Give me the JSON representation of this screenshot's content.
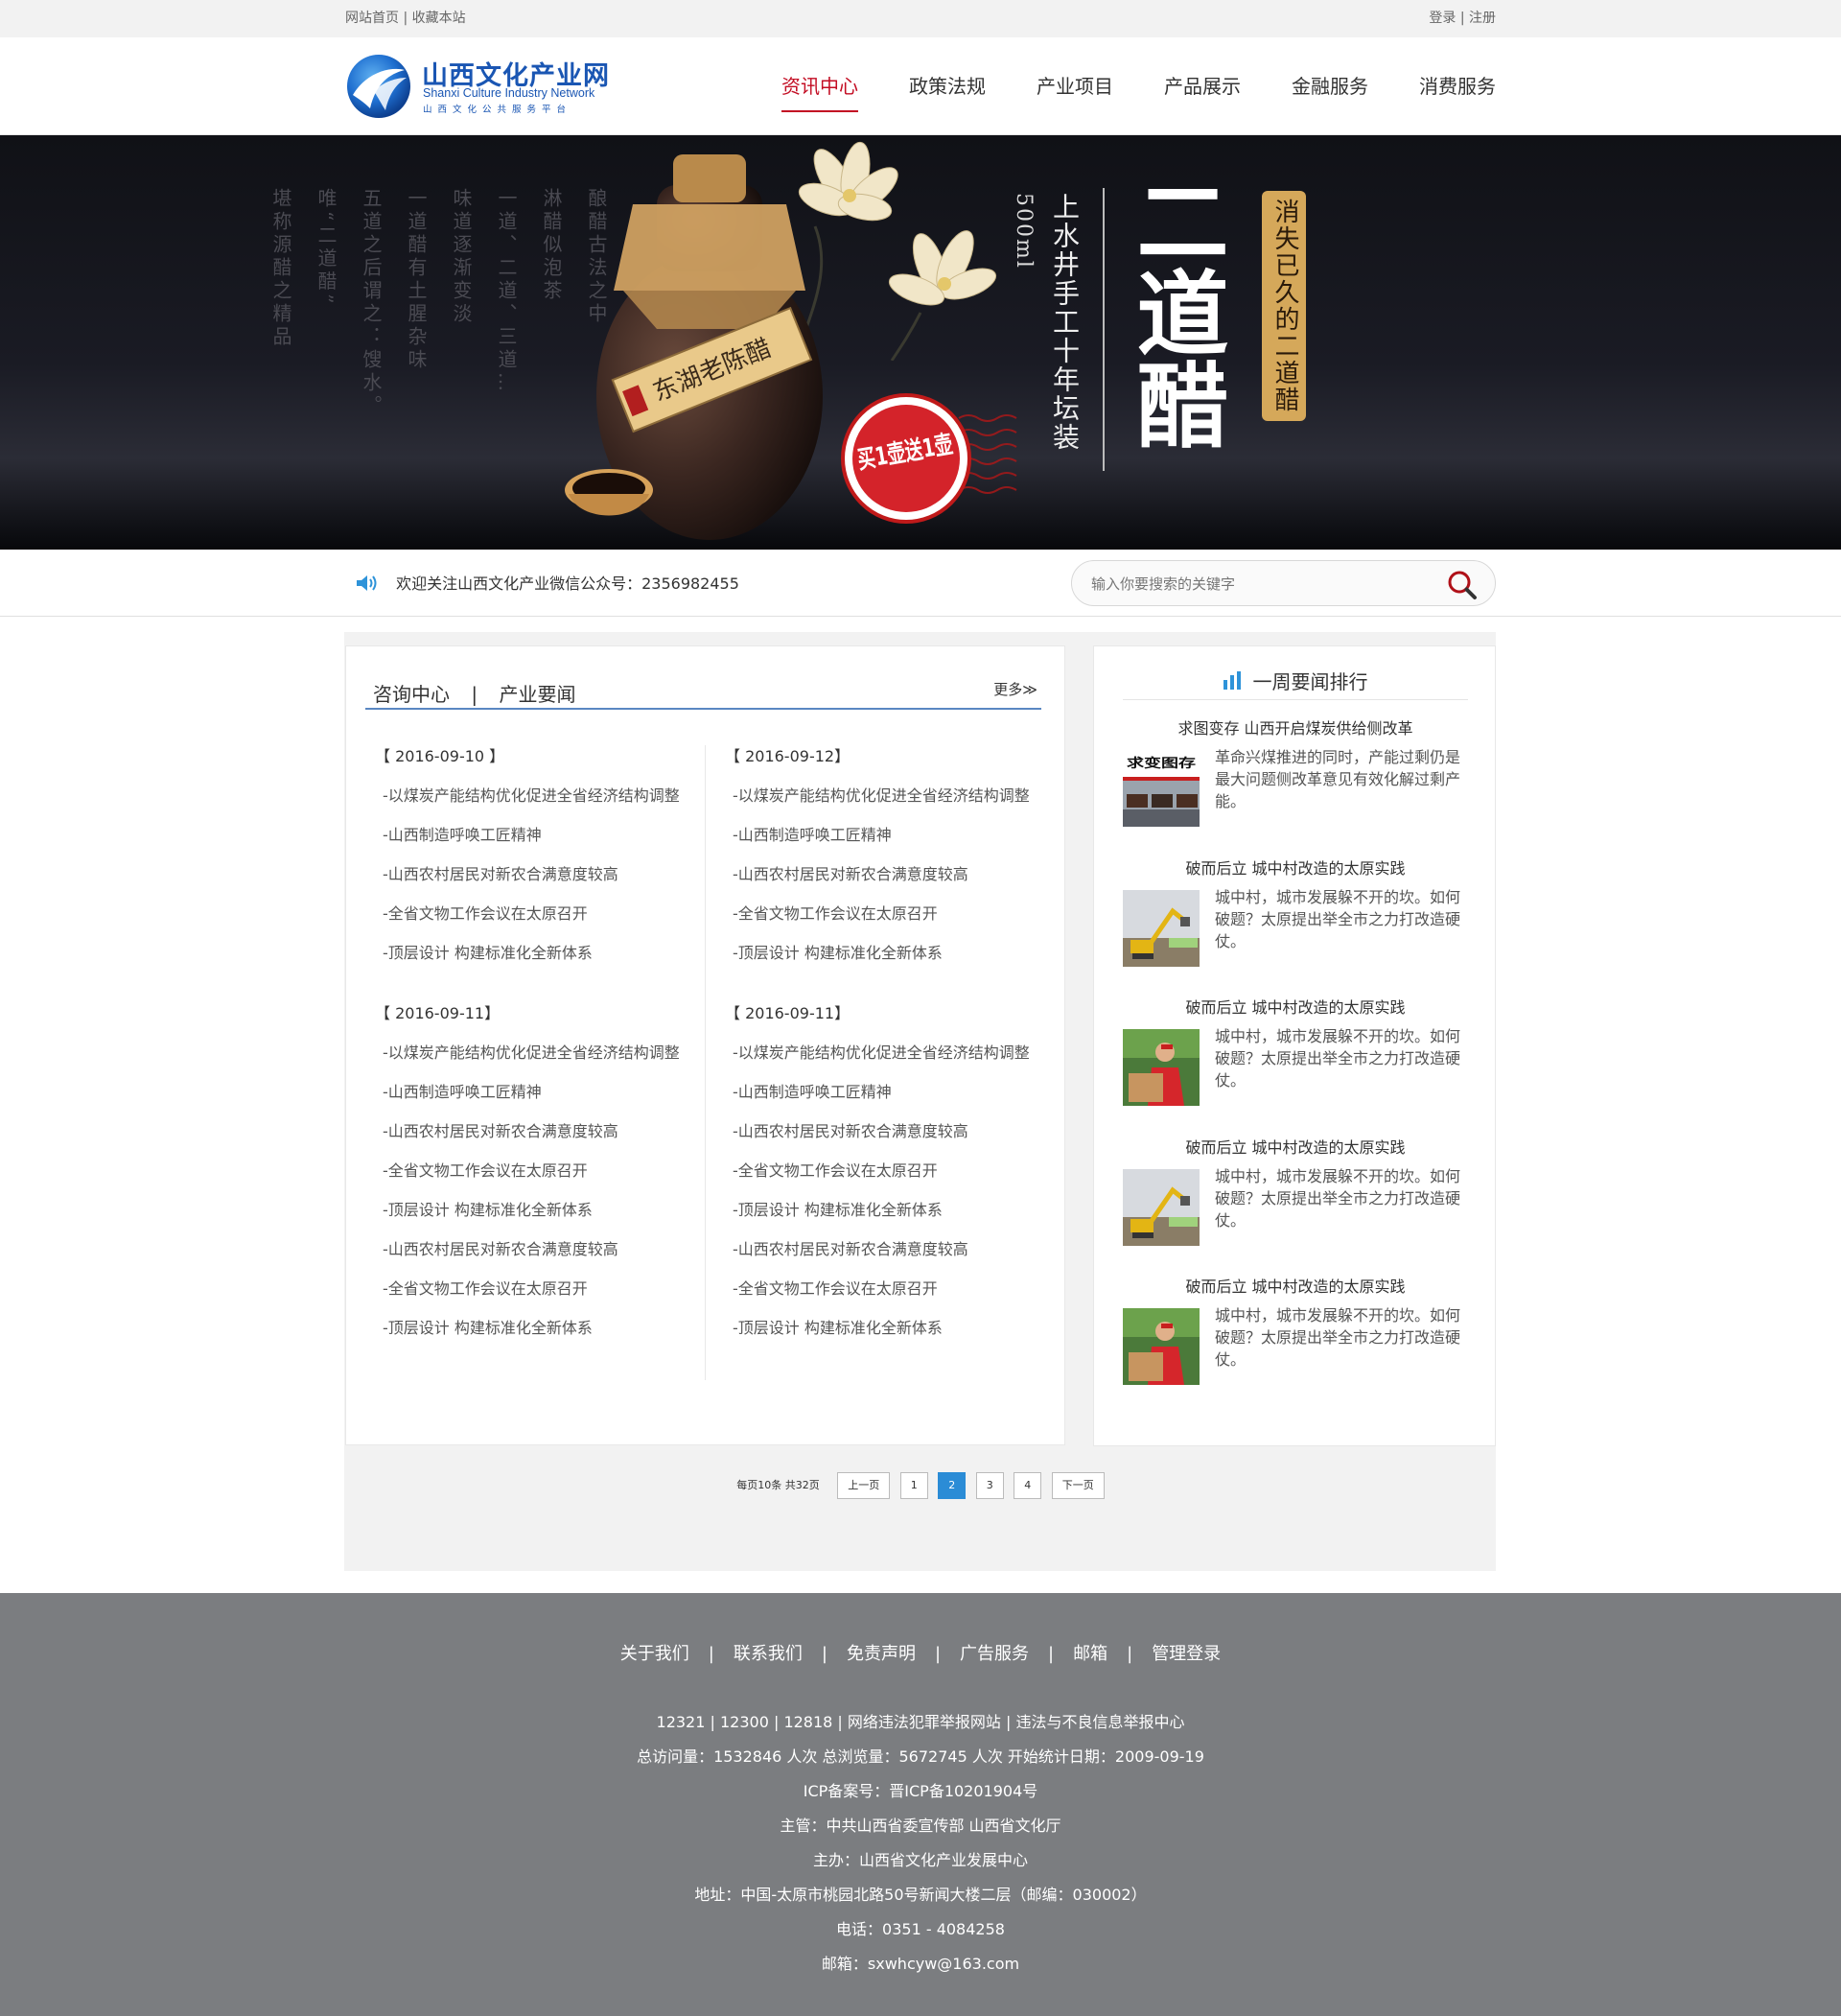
{
  "topbar": {
    "home": "网站首页",
    "sep": "|",
    "bookmark": "收藏本站",
    "login": "登录",
    "register": "注册"
  },
  "logo": {
    "title": "山西文化产业网",
    "en": "Shanxi Culture Industry Network",
    "sub": "山西文化公共服务平台"
  },
  "nav": [
    "资讯中心",
    "政策法规",
    "产业项目",
    "产品展示",
    "金融服务",
    "消费服务"
  ],
  "banner": {
    "poem": [
      "酿醋古法之中",
      "淋醋似泡茶",
      "一道、二道、三道…",
      "味道逐渐变淡",
      "一道醋有土腥杂味",
      "五道之后谓之：馊水。",
      "唯“二道醋”",
      "堪称源醋之精品"
    ],
    "bottle_label": "东湖老陈醋",
    "badge": "买1壶送1壶",
    "volume": "500ml",
    "subtitle": "上水井手工十年坛装",
    "title": "二道醋",
    "tag": "消失已久的二道醋"
  },
  "notice": {
    "text": "欢迎关注山西文化产业微信公众号：2356982455"
  },
  "search": {
    "placeholder": "输入你要搜索的关键字"
  },
  "left": {
    "title": "咨询中心",
    "divider": "|",
    "subtitle": "产业要闻",
    "more": "更多≫",
    "columns": [
      [
        {
          "date": "【 2016-09-10 】",
          "items": [
            "-以煤炭产能结构优化促进全省经济结构调整",
            "-山西制造呼唤工匠精神",
            "-山西农村居民对新农合满意度较高",
            "-全省文物工作会议在太原召开",
            "-顶层设计 构建标准化全新体系"
          ]
        },
        {
          "date": "【 2016-09-11】",
          "items": [
            "-以煤炭产能结构优化促进全省经济结构调整",
            "-山西制造呼唤工匠精神",
            "-山西农村居民对新农合满意度较高",
            "-全省文物工作会议在太原召开",
            "-顶层设计 构建标准化全新体系",
            "-山西农村居民对新农合满意度较高",
            "-全省文物工作会议在太原召开",
            "-顶层设计 构建标准化全新体系"
          ]
        }
      ],
      [
        {
          "date": "【 2016-09-12】",
          "items": [
            "-以煤炭产能结构优化促进全省经济结构调整",
            "-山西制造呼唤工匠精神",
            "-山西农村居民对新农合满意度较高",
            "-全省文物工作会议在太原召开",
            "-顶层设计 构建标准化全新体系"
          ]
        },
        {
          "date": "【 2016-09-11】",
          "items": [
            "-以煤炭产能结构优化促进全省经济结构调整",
            "-山西制造呼唤工匠精神",
            "-山西农村居民对新农合满意度较高",
            "-全省文物工作会议在太原召开",
            "-顶层设计 构建标准化全新体系",
            "-山西农村居民对新农合满意度较高",
            "-全省文物工作会议在太原召开",
            "-顶层设计 构建标准化全新体系"
          ]
        }
      ]
    ]
  },
  "right": {
    "title": "一周要闻排行",
    "items": [
      {
        "title": "求图变存 山西开启煤炭供给侧改革",
        "desc": "革命兴煤推进的同时，产能过剩仍是最大问题侧改革意见有效化解过剩产能。",
        "thumb_text": "求变图存",
        "thumb": "coal"
      },
      {
        "title": "破而后立 城中村改造的太原实践",
        "desc": "城中村，城市发展躲不开的坎。如何破题？太原提出举全市之力打改造硬仗。",
        "thumb": "excavator"
      },
      {
        "title": "破而后立 城中村改造的太原实践",
        "desc": "城中村，城市发展躲不开的坎。如何破题？太原提出举全市之力打改造硬仗。",
        "thumb": "worker"
      },
      {
        "title": "破而后立 城中村改造的太原实践",
        "desc": "城中村，城市发展躲不开的坎。如何破题？太原提出举全市之力打改造硬仗。",
        "thumb": "excavator"
      },
      {
        "title": "破而后立 城中村改造的太原实践",
        "desc": "城中村，城市发展躲不开的坎。如何破题？太原提出举全市之力打改造硬仗。",
        "thumb": "worker"
      }
    ]
  },
  "pager": {
    "info": "每页10条 共32页",
    "prev": "上一页",
    "pages": [
      "1",
      "2",
      "3",
      "4"
    ],
    "current": "2",
    "next": "下一页"
  },
  "footer": {
    "links": [
      "关于我们",
      "联系我们",
      "免责声明",
      "广告服务",
      "邮箱",
      "管理登录"
    ],
    "link_sep": "|",
    "lines": [
      "12321 | 12300 | 12818 | 网络违法犯罪举报网站 | 违法与不良信息举报中心",
      "总访问量：1532846 人次  总浏览量：5672745 人次  开始统计日期：2009-09-19",
      "ICP备案号：晋ICP备10201904号",
      "主管：中共山西省委宣传部 山西省文化厅",
      "主办：山西省文化产业发展中心",
      "地址：中国-太原市桃园北路50号新闻大楼二层（邮编：030002）",
      "电话：0351 - 4084258",
      "邮箱：sxwhcyw@163.com"
    ]
  },
  "colors": {
    "brand_blue": "#1a56b3",
    "nav_active": "#c30d23",
    "pager_current": "#2b8cd6",
    "footer_bg": "#7b7d80",
    "heading_line": "#5a87c2",
    "vinegar_badge": "#d5a85a"
  },
  "icons": [
    "logo-swirl-icon",
    "speaker-icon",
    "search-icon",
    "bar-chart-icon"
  ]
}
